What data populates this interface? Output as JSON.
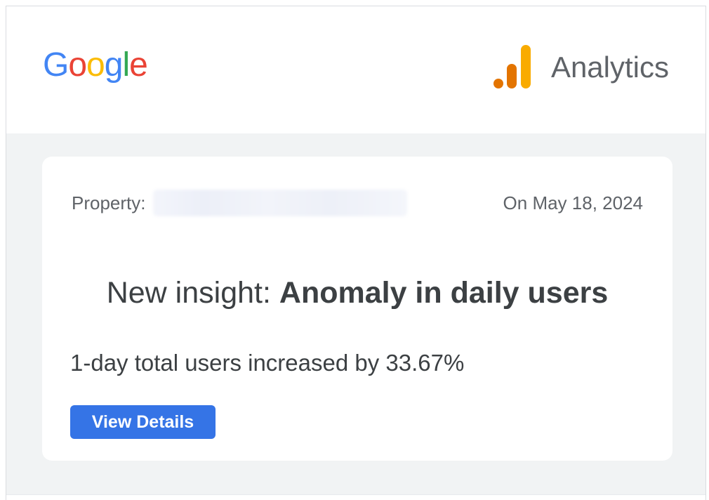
{
  "header": {
    "google_logo": {
      "letters": [
        "G",
        "o",
        "o",
        "g",
        "l",
        "e"
      ],
      "colors": [
        "#4285F4",
        "#EA4335",
        "#FBBC05",
        "#4285F4",
        "#34A853",
        "#EA4335"
      ]
    },
    "analytics_logo": {
      "icon": "analytics-bars-icon",
      "text": "Analytics",
      "colors": [
        "#E37400",
        "#F9AB00",
        "#F9AB00"
      ]
    }
  },
  "card": {
    "property_label": "Property:",
    "property_value": "",
    "date": "On May 18, 2024",
    "headline_prefix": "New insight: ",
    "headline_bold": "Anomaly in daily users",
    "summary": "1-day total users increased by 33.67%",
    "button_label": "View Details"
  },
  "colors": {
    "button": "#3574E6",
    "page_background": "#F1F3F4",
    "card_background": "#FFFFFF",
    "text_primary": "#3C4043",
    "text_secondary": "#5F6368"
  }
}
